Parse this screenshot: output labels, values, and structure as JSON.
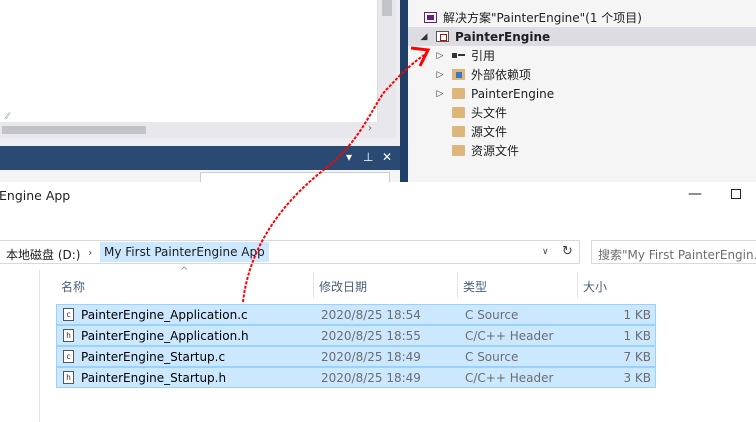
{
  "solution_explorer": {
    "solution": "解决方案\"PainterEngine\"(1 个项目)",
    "project": "PainterEngine",
    "items": [
      {
        "label": "引用",
        "icon": "reference-icon"
      },
      {
        "label": "外部依赖项",
        "icon": "external-dependencies-icon"
      },
      {
        "label": "PainterEngine",
        "icon": "folder-icon"
      },
      {
        "label": "头文件",
        "icon": "folder-icon"
      },
      {
        "label": "源文件",
        "icon": "folder-icon"
      },
      {
        "label": "资源文件",
        "icon": "folder-icon"
      }
    ]
  },
  "explorer": {
    "title": "Engine App",
    "breadcrumb": {
      "drive": "本地磁盘 (D:)",
      "folder": "My First PainterEngine App"
    },
    "search_placeholder": "搜索\"My First PainterEngin...",
    "columns": {
      "name": "名称",
      "date": "修改日期",
      "type": "类型",
      "size": "大小"
    },
    "files": [
      {
        "name": "PainterEngine_Application.c",
        "date": "2020/8/25 18:54",
        "type": "C Source",
        "size": "1 KB",
        "icon": "c-file-icon"
      },
      {
        "name": "PainterEngine_Application.h",
        "date": "2020/8/25 18:55",
        "type": "C/C++ Header",
        "size": "1 KB",
        "icon": "h-file-icon"
      },
      {
        "name": "PainterEngine_Startup.c",
        "date": "2020/8/25 18:49",
        "type": "C Source",
        "size": "7 KB",
        "icon": "c-file-icon"
      },
      {
        "name": "PainterEngine_Startup.h",
        "date": "2020/8/25 18:49",
        "type": "C/C++ Header",
        "size": "3 KB",
        "icon": "h-file-icon"
      }
    ]
  },
  "colors": {
    "annotation_arrow": "#ff0000",
    "selection": "#cce8ff",
    "vs_title_bar": "#2a4a73"
  }
}
